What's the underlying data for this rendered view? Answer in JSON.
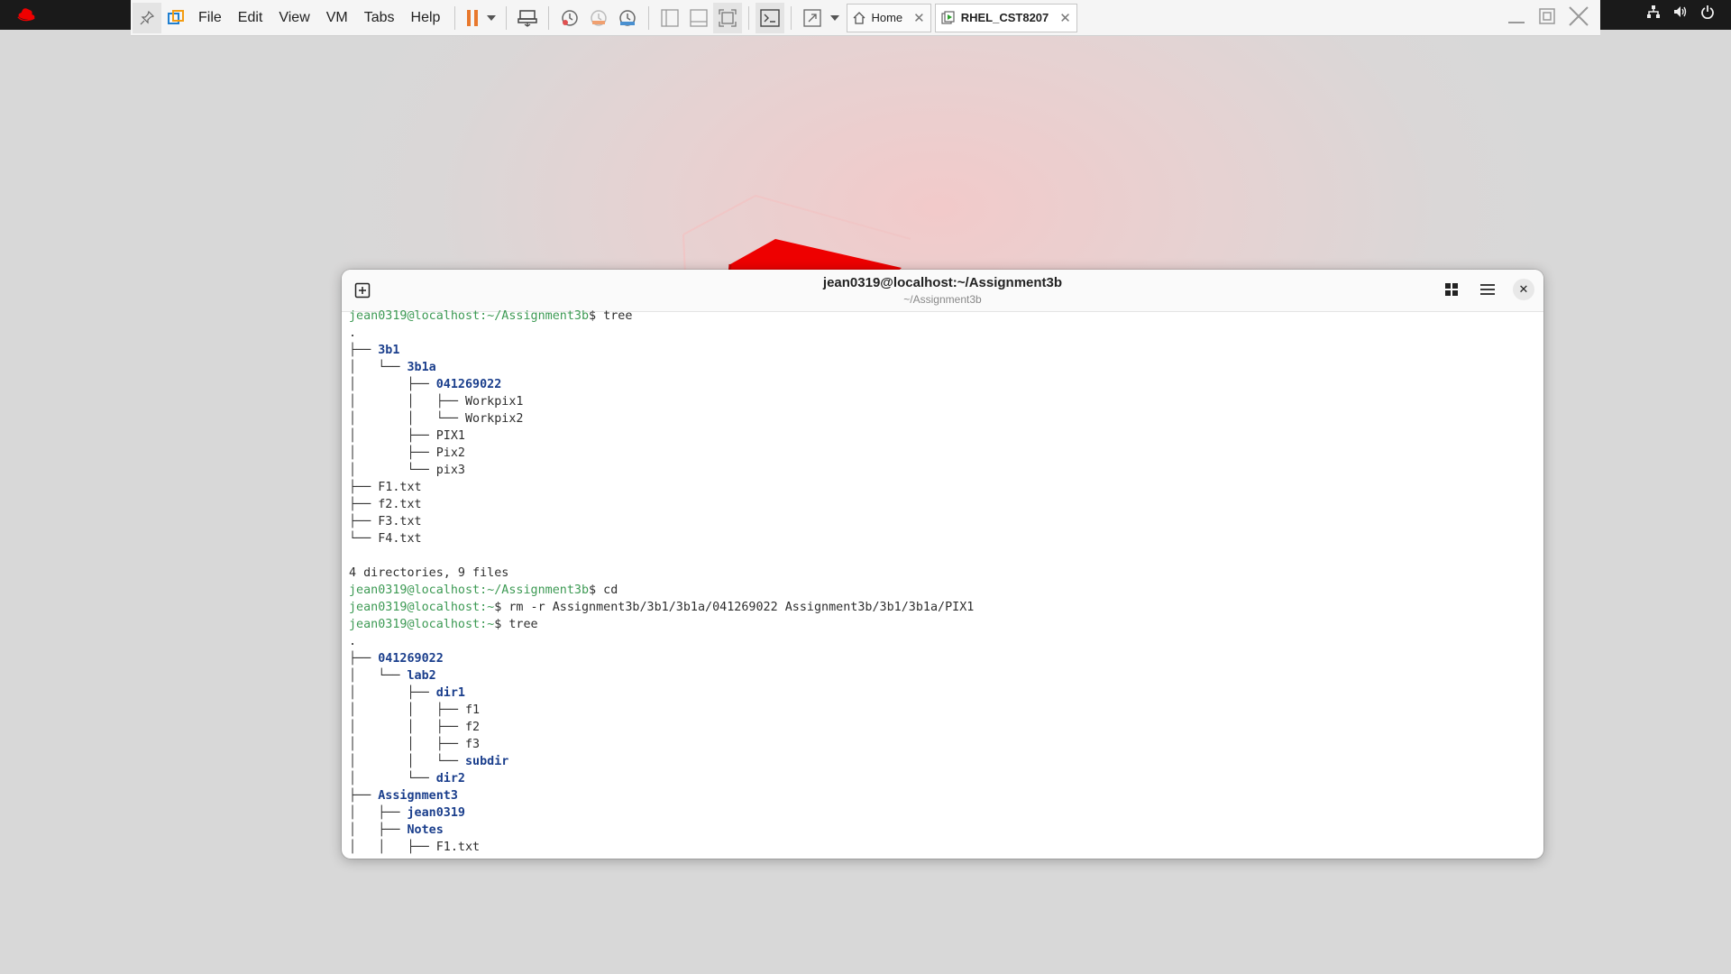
{
  "vm_toolbar": {
    "menu": [
      "File",
      "Edit",
      "View",
      "VM",
      "Tabs",
      "Help"
    ],
    "tabs": [
      {
        "label": "Home",
        "active": false
      },
      {
        "label": "RHEL_CST8207",
        "active": true
      }
    ],
    "icons": [
      "pin-icon",
      "vmware-logo-icon",
      "pause-icon",
      "dropdown-icon",
      "send-keys-icon",
      "snapshot-icon",
      "revert-icon",
      "snapshot-manager-icon",
      "single-window-icon",
      "console-view-icon",
      "fullscreen-fit-icon",
      "terminal-icon",
      "stretch-icon"
    ]
  },
  "terminal": {
    "title": "jean0319@localhost:~/Assignment3b",
    "subtitle": "~/Assignment3b",
    "lines": [
      [
        {
          "t": "jean0319@localhost:~/Assignment3b",
          "c": "prompt"
        },
        {
          "t": "$ tree",
          "c": ""
        }
      ],
      [
        {
          "t": ".",
          "c": ""
        }
      ],
      [
        {
          "t": "├── ",
          "c": "tree"
        },
        {
          "t": "3b1",
          "c": "dir"
        }
      ],
      [
        {
          "t": "│   └── ",
          "c": "tree"
        },
        {
          "t": "3b1a",
          "c": "dir"
        }
      ],
      [
        {
          "t": "│       ├── ",
          "c": "tree"
        },
        {
          "t": "041269022",
          "c": "dir"
        }
      ],
      [
        {
          "t": "│       │   ├── ",
          "c": "tree"
        },
        {
          "t": "Workpix1",
          "c": ""
        }
      ],
      [
        {
          "t": "│       │   └── ",
          "c": "tree"
        },
        {
          "t": "Workpix2",
          "c": ""
        }
      ],
      [
        {
          "t": "│       ├── ",
          "c": "tree"
        },
        {
          "t": "PIX1",
          "c": ""
        }
      ],
      [
        {
          "t": "│       ├── ",
          "c": "tree"
        },
        {
          "t": "Pix2",
          "c": ""
        }
      ],
      [
        {
          "t": "│       └── ",
          "c": "tree"
        },
        {
          "t": "pix3",
          "c": ""
        }
      ],
      [
        {
          "t": "├── ",
          "c": "tree"
        },
        {
          "t": "F1.txt",
          "c": ""
        }
      ],
      [
        {
          "t": "├── ",
          "c": "tree"
        },
        {
          "t": "f2.txt",
          "c": ""
        }
      ],
      [
        {
          "t": "├── ",
          "c": "tree"
        },
        {
          "t": "F3.txt",
          "c": ""
        }
      ],
      [
        {
          "t": "└── ",
          "c": "tree"
        },
        {
          "t": "F4.txt",
          "c": ""
        }
      ],
      [
        {
          "t": "",
          "c": ""
        }
      ],
      [
        {
          "t": "4 directories, 9 files",
          "c": ""
        }
      ],
      [
        {
          "t": "jean0319@localhost:~/Assignment3b",
          "c": "prompt"
        },
        {
          "t": "$ cd",
          "c": ""
        }
      ],
      [
        {
          "t": "jean0319@localhost:~",
          "c": "prompt"
        },
        {
          "t": "$ rm -r Assignment3b/3b1/3b1a/041269022 Assignment3b/3b1/3b1a/PIX1",
          "c": ""
        }
      ],
      [
        {
          "t": "jean0319@localhost:~",
          "c": "prompt"
        },
        {
          "t": "$ tree",
          "c": ""
        }
      ],
      [
        {
          "t": ".",
          "c": ""
        }
      ],
      [
        {
          "t": "├── ",
          "c": "tree"
        },
        {
          "t": "041269022",
          "c": "dir"
        }
      ],
      [
        {
          "t": "│   └── ",
          "c": "tree"
        },
        {
          "t": "lab2",
          "c": "dir"
        }
      ],
      [
        {
          "t": "│       ├── ",
          "c": "tree"
        },
        {
          "t": "dir1",
          "c": "dir"
        }
      ],
      [
        {
          "t": "│       │   ├── ",
          "c": "tree"
        },
        {
          "t": "f1",
          "c": ""
        }
      ],
      [
        {
          "t": "│       │   ├── ",
          "c": "tree"
        },
        {
          "t": "f2",
          "c": ""
        }
      ],
      [
        {
          "t": "│       │   ├── ",
          "c": "tree"
        },
        {
          "t": "f3",
          "c": ""
        }
      ],
      [
        {
          "t": "│       │   └── ",
          "c": "tree"
        },
        {
          "t": "subdir",
          "c": "dir"
        }
      ],
      [
        {
          "t": "│       └── ",
          "c": "tree"
        },
        {
          "t": "dir2",
          "c": "dir"
        }
      ],
      [
        {
          "t": "├── ",
          "c": "tree"
        },
        {
          "t": "Assignment3",
          "c": "dir"
        }
      ],
      [
        {
          "t": "│   ├── ",
          "c": "tree"
        },
        {
          "t": "jean0319",
          "c": "dir"
        }
      ],
      [
        {
          "t": "│   ├── ",
          "c": "tree"
        },
        {
          "t": "Notes",
          "c": "dir"
        }
      ],
      [
        {
          "t": "│   │   ├── ",
          "c": "tree"
        },
        {
          "t": "F1.txt",
          "c": ""
        }
      ]
    ]
  },
  "colors": {
    "prompt": "#3d9a54",
    "directory": "#1a3e8c",
    "accent": "#e8782c"
  }
}
